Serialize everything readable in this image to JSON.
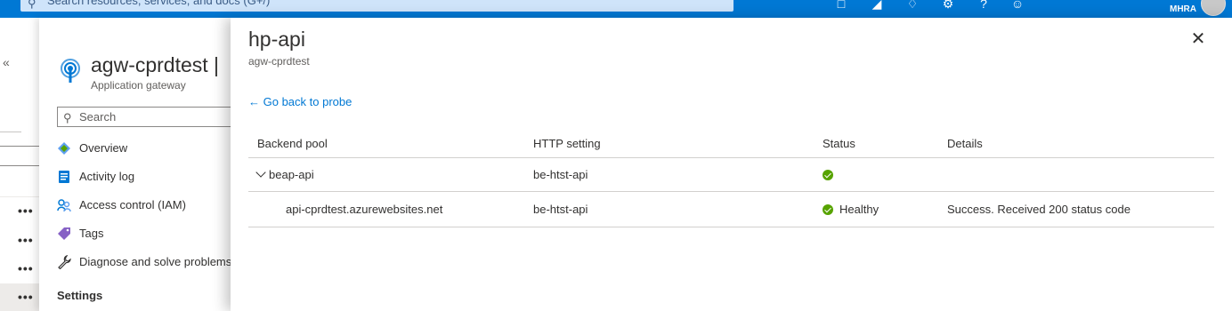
{
  "topbar": {
    "search_placeholder": "Search resources, services, and docs (G+/)",
    "user": "MHRA",
    "icons": [
      "cloud-shell-icon",
      "directory-filter-icon",
      "notifications-icon",
      "settings-icon",
      "help-icon",
      "feedback-icon"
    ]
  },
  "resource": {
    "title": "agw-cprdtest |",
    "subtitle": "Application gateway",
    "search_placeholder": "Search",
    "nav": [
      {
        "label": "Overview",
        "icon": "overview-icon"
      },
      {
        "label": "Activity log",
        "icon": "activity-log-icon"
      },
      {
        "label": "Access control (IAM)",
        "icon": "access-control-icon"
      },
      {
        "label": "Tags",
        "icon": "tag-icon"
      },
      {
        "label": "Diagnose and solve problems",
        "icon": "wrench-icon"
      }
    ],
    "section": "Settings"
  },
  "panel": {
    "title": "hp-api",
    "subtitle": "agw-cprdtest",
    "back_link": "Go back to probe",
    "columns": [
      "Backend pool",
      "HTTP setting",
      "Status",
      "Details"
    ],
    "rows": [
      {
        "pool": "beap-api",
        "setting": "be-htst-api",
        "status": "",
        "details": ""
      },
      {
        "pool": "api-cprdtest.azurewebsites.net",
        "setting": "be-htst-api",
        "status": "Healthy",
        "details": "Success. Received 200 status code"
      }
    ]
  },
  "colors": {
    "accent": "#0078d4",
    "healthy": "#57a300"
  }
}
